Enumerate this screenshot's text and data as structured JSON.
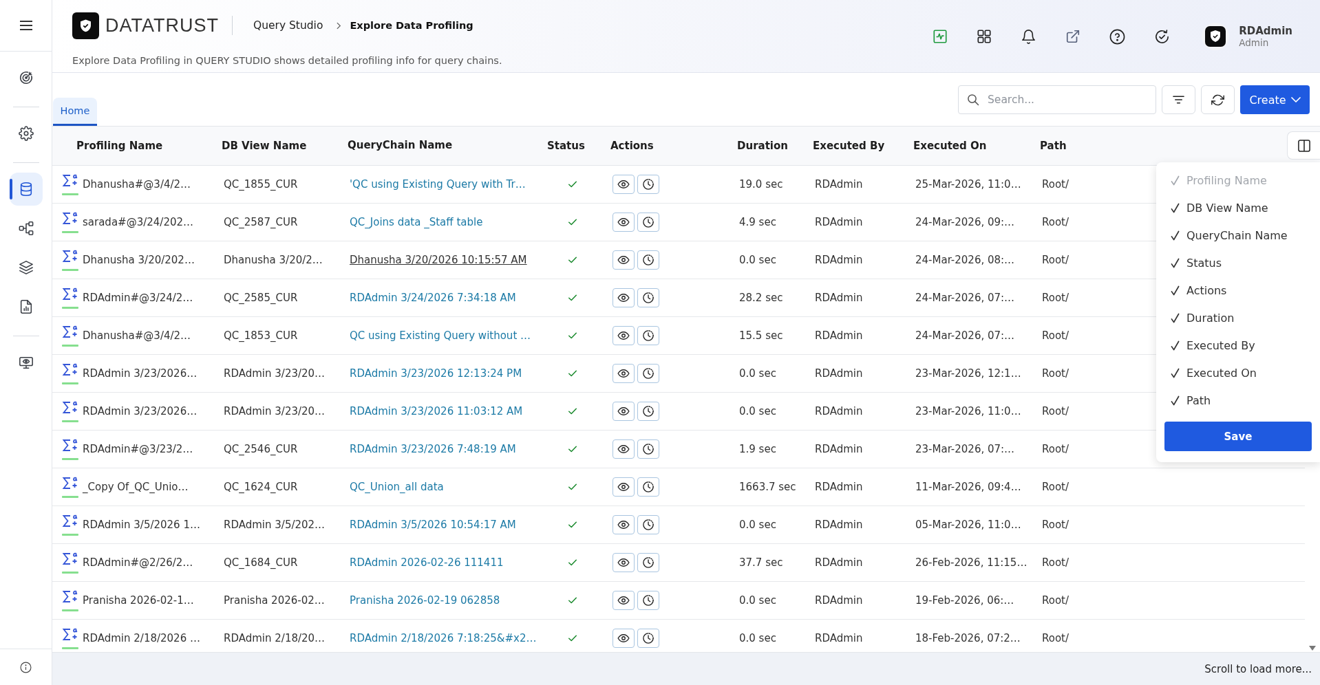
{
  "sidebar": {
    "groups": [
      [
        {
          "kind": "target",
          "selected": false
        }
      ],
      [
        {
          "kind": "settings",
          "selected": false
        }
      ],
      [
        {
          "kind": "database",
          "selected": true
        },
        {
          "kind": "flow",
          "selected": false
        },
        {
          "kind": "layers",
          "selected": false
        },
        {
          "kind": "report",
          "selected": false
        }
      ],
      [
        {
          "kind": "monitor",
          "selected": false
        }
      ]
    ]
  },
  "header": {
    "logo": "DATATRUST",
    "breadcrumb": [
      {
        "label": "Query Studio",
        "current": false
      },
      {
        "label": "Explore Data Profiling",
        "current": true
      }
    ],
    "description": "Explore Data Profiling in QUERY STUDIO shows detailed profiling info for query chains.",
    "user": {
      "name": "RDAdmin",
      "role": "Admin"
    }
  },
  "tabs": [
    {
      "label": "Home",
      "selected": true
    }
  ],
  "search": {
    "placeholder": "Search..."
  },
  "create_button": {
    "label": "Create"
  },
  "table": {
    "columns": [
      "Profiling Name",
      "DB View Name",
      "QueryChain Name",
      "Status",
      "Actions",
      "Duration",
      "Executed By",
      "Executed On",
      "Path"
    ],
    "rows": [
      {
        "profiling_name": "Dhanusha#@3/4/2…",
        "db_view_name": "QC_1855_CUR",
        "querychain_name": "'QC using Existing Query with Tr…",
        "link_hovered": false,
        "succeeded": true,
        "duration": "19.0 sec",
        "executed_by": "RDAdmin",
        "executed_on": "25-Mar-2026, 11:0…",
        "path": "Root/"
      },
      {
        "profiling_name": "sarada#@3/24/202…",
        "db_view_name": "QC_2587_CUR",
        "querychain_name": "QC_Joins data _Staff table",
        "link_hovered": false,
        "succeeded": true,
        "duration": "4.9 sec",
        "executed_by": "RDAdmin",
        "executed_on": "24-Mar-2026, 09:…",
        "path": "Root/"
      },
      {
        "profiling_name": "Dhanusha 3/20/202…",
        "db_view_name": "Dhanusha 3/20/2…",
        "querychain_name": "Dhanusha 3/20/2026 10:15:57 AM",
        "link_hovered": true,
        "succeeded": true,
        "duration": "0.0 sec",
        "executed_by": "RDAdmin",
        "executed_on": "24-Mar-2026, 08:…",
        "path": "Root/"
      },
      {
        "profiling_name": "RDAdmin#@3/24/2…",
        "db_view_name": "QC_2585_CUR",
        "querychain_name": "RDAdmin 3/24/2026 7:34:18 AM",
        "link_hovered": false,
        "succeeded": true,
        "duration": "28.2 sec",
        "executed_by": "RDAdmin",
        "executed_on": "24-Mar-2026, 07:…",
        "path": "Root/"
      },
      {
        "profiling_name": "Dhanusha#@3/4/2…",
        "db_view_name": "QC_1853_CUR",
        "querychain_name": "QC using Existing Query without …",
        "link_hovered": false,
        "succeeded": true,
        "duration": "15.5 sec",
        "executed_by": "RDAdmin",
        "executed_on": "24-Mar-2026, 07:…",
        "path": "Root/"
      },
      {
        "profiling_name": "RDAdmin 3/23/2026…",
        "db_view_name": "RDAdmin 3/23/20…",
        "querychain_name": "RDAdmin 3/23/2026 12:13:24 PM",
        "link_hovered": false,
        "succeeded": true,
        "duration": "0.0 sec",
        "executed_by": "RDAdmin",
        "executed_on": "23-Mar-2026, 12:1…",
        "path": "Root/"
      },
      {
        "profiling_name": "RDAdmin 3/23/2026…",
        "db_view_name": "RDAdmin 3/23/20…",
        "querychain_name": "RDAdmin 3/23/2026 11:03:12 AM",
        "link_hovered": false,
        "succeeded": true,
        "duration": "0.0 sec",
        "executed_by": "RDAdmin",
        "executed_on": "23-Mar-2026, 11:0…",
        "path": "Root/"
      },
      {
        "profiling_name": "RDAdmin#@3/23/2…",
        "db_view_name": "QC_2546_CUR",
        "querychain_name": "RDAdmin 3/23/2026 7:48:19 AM",
        "link_hovered": false,
        "succeeded": true,
        "duration": "1.9 sec",
        "executed_by": "RDAdmin",
        "executed_on": "23-Mar-2026, 07:…",
        "path": "Root/"
      },
      {
        "profiling_name": "_Copy Of_QC_Unio…",
        "db_view_name": "QC_1624_CUR",
        "querychain_name": "QC_Union_all data",
        "link_hovered": false,
        "succeeded": true,
        "duration": "1663.7 sec",
        "executed_by": "RDAdmin",
        "executed_on": "11-Mar-2026, 09:4…",
        "path": "Root/"
      },
      {
        "profiling_name": "RDAdmin 3/5/2026 1…",
        "db_view_name": "RDAdmin 3/5/202…",
        "querychain_name": "RDAdmin 3/5/2026 10:54:17 AM",
        "link_hovered": false,
        "succeeded": true,
        "duration": "0.0 sec",
        "executed_by": "RDAdmin",
        "executed_on": "05-Mar-2026, 11:0…",
        "path": "Root/"
      },
      {
        "profiling_name": "RDAdmin#@2/26/2…",
        "db_view_name": "QC_1684_CUR",
        "querychain_name": "RDAdmin 2026-02-26 111411",
        "link_hovered": false,
        "succeeded": true,
        "duration": "37.7 sec",
        "executed_by": "RDAdmin",
        "executed_on": "26-Feb-2026, 11:15…",
        "path": "Root/"
      },
      {
        "profiling_name": "Pranisha 2026-02-1…",
        "db_view_name": "Pranisha 2026-02…",
        "querychain_name": "Pranisha 2026-02-19 062858",
        "link_hovered": false,
        "succeeded": true,
        "duration": "0.0 sec",
        "executed_by": "RDAdmin",
        "executed_on": "19-Feb-2026, 06:…",
        "path": "Root/"
      },
      {
        "profiling_name": "RDAdmin 2/18/2026 …",
        "db_view_name": "RDAdmin 2/18/20…",
        "querychain_name": "RDAdmin 2/18/2026 7:18:25&#x2…",
        "link_hovered": false,
        "succeeded": true,
        "duration": "0.0 sec",
        "executed_by": "RDAdmin",
        "executed_on": "18-Feb-2026, 07:2…",
        "path": "Root/"
      }
    ]
  },
  "column_menu": {
    "items": [
      {
        "label": "Profiling Name",
        "checked": true,
        "disabled": true
      },
      {
        "label": "DB View Name",
        "checked": true,
        "disabled": false
      },
      {
        "label": "QueryChain Name",
        "checked": true,
        "disabled": false
      },
      {
        "label": "Status",
        "checked": true,
        "disabled": false
      },
      {
        "label": "Actions",
        "checked": true,
        "disabled": false
      },
      {
        "label": "Duration",
        "checked": true,
        "disabled": false
      },
      {
        "label": "Executed By",
        "checked": true,
        "disabled": false
      },
      {
        "label": "Executed On",
        "checked": true,
        "disabled": false
      },
      {
        "label": "Path",
        "checked": true,
        "disabled": false
      }
    ],
    "save": "Save"
  },
  "footer": {
    "text": "Scroll to load more..."
  }
}
